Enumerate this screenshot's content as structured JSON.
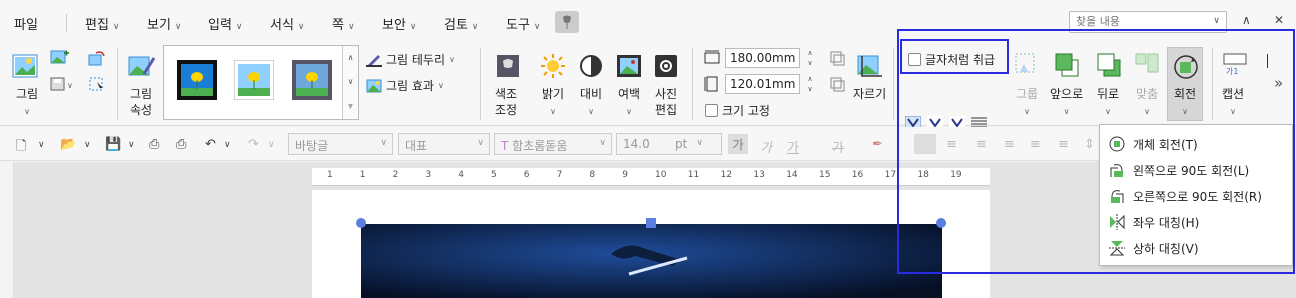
{
  "menubar": {
    "items": [
      {
        "label": "파일",
        "has_chevron": false
      },
      {
        "label": "편집",
        "has_chevron": true
      },
      {
        "label": "보기",
        "has_chevron": true
      },
      {
        "label": "입력",
        "has_chevron": true
      },
      {
        "label": "서식",
        "has_chevron": true
      },
      {
        "label": "쪽",
        "has_chevron": true
      },
      {
        "label": "보안",
        "has_chevron": true
      },
      {
        "label": "검토",
        "has_chevron": true
      },
      {
        "label": "도구",
        "has_chevron": true
      }
    ],
    "search_placeholder": "찾을 내용",
    "minimize_glyph": "∧",
    "close_glyph": "✕"
  },
  "ribbon": {
    "picture_label": "그림",
    "picture_props_label": "그림\n속성",
    "border_label": "그림 테두리",
    "effect_label": "그림 효과",
    "color_adjust_label": "색조\n조정",
    "brightness_label": "밝기",
    "contrast_label": "대비",
    "margin_label": "여백",
    "photo_edit_label": "사진\n편집",
    "width_value": "180.00",
    "height_value": "120.01",
    "unit": "mm",
    "fix_size_label": "크기 고정",
    "crop_label": "자르기",
    "treat_as_char_label": "글자처럼 취급",
    "group_label": "그룹",
    "bring_forward_label": "앞으로",
    "send_backward_label": "뒤로",
    "align_label": "맞춤",
    "rotate_label": "회전",
    "caption_label": "캡션",
    "more_glyph": "»"
  },
  "toolbar2": {
    "style_value": "바탕글",
    "lang_value": "대표",
    "font_value": "함초롬돋움",
    "size_value": "14.0",
    "size_unit": "pt",
    "bold_glyph": "가",
    "italic_glyph": "가",
    "underline_glyph": "가",
    "strike_glyph": "가"
  },
  "ruler": {
    "numbers": [
      "1",
      "1",
      "2",
      "3",
      "4",
      "5",
      "6",
      "7",
      "8",
      "9",
      "10",
      "11",
      "12",
      "13",
      "14",
      "15",
      "16",
      "17",
      "18",
      "19"
    ]
  },
  "rotate_menu": {
    "items": [
      {
        "label": "개체 회전(T)",
        "icon": "free-rotate-icon"
      },
      {
        "label": "왼쪽으로 90도 회전(L)",
        "icon": "rotate-left-icon"
      },
      {
        "label": "오른쪽으로 90도 회전(R)",
        "icon": "rotate-right-icon"
      },
      {
        "label": "좌우 대칭(H)",
        "icon": "flip-horizontal-icon"
      },
      {
        "label": "상하 대칭(V)",
        "icon": "flip-vertical-icon"
      }
    ]
  },
  "colors": {
    "highlight": "#2a2adf",
    "handle": "#5b7fe0",
    "photo_bg": "#0a1a3a",
    "accent_green": "#4caf50"
  }
}
